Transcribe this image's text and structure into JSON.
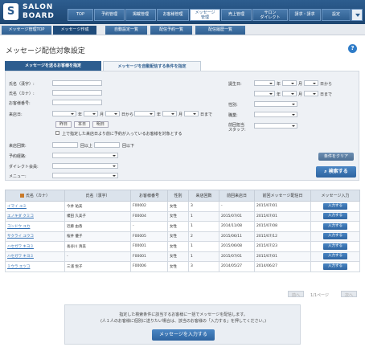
{
  "app": {
    "logo_line1": "SALON",
    "logo_line2": "BOARD",
    "logo_mark": "S"
  },
  "nav": [
    {
      "label": "TOP"
    },
    {
      "label": "予約管理"
    },
    {
      "label": "掲載管理"
    },
    {
      "label": "お客様管理"
    },
    {
      "label1": "メッセージ",
      "label2": "管理"
    },
    {
      "label": "売上管理"
    },
    {
      "label1": "サロン",
      "label2": "ダイレクト"
    },
    {
      "label": "請求・請求"
    },
    {
      "label": "設定"
    }
  ],
  "subtabs": [
    {
      "label": "メッセージ管理TOP"
    },
    {
      "label": "メッセージ作成"
    },
    {
      "label": "自動設定一覧"
    },
    {
      "label": "配信予約一覧"
    },
    {
      "label": "配信履歴一覧"
    }
  ],
  "page_title": "メッセージ配信対象設定",
  "tabs": {
    "specify": "メッセージを送るお客様を指定",
    "auto": "メッセージを自動配信する条件を指定"
  },
  "form": {
    "name_kanji": "氏名（漢字）:",
    "name_kana": "氏名（カナ）:",
    "customer_no": "お客様番号:",
    "visit_date": "来店日:",
    "year": "年",
    "month": "月",
    "day_from": "日から",
    "day_to": "日まで",
    "yesterday": "昨日",
    "today": "本日",
    "tomorrow": "明日",
    "checkbox_label": "上で指定した来店日より前に予約が入っているお客様を対象とする",
    "visit_count": "来店回数:",
    "count_from": "回以上",
    "count_to": "回以下",
    "route": "予約経路:",
    "direct_member": "ダイレクト会員:",
    "menu": "メニュー:",
    "birthday": "誕生日:",
    "gender": "性別:",
    "job": "職業:",
    "last_staff1": "前回担当",
    "last_staff2": "スタッフ:",
    "clear_button": "条件をクリア",
    "search_button": "検索する",
    "search_icon": "search-icon"
  },
  "table": {
    "headers": [
      "氏名（カナ）",
      "氏名（漢字）",
      "お客様番号",
      "性別",
      "来店回数",
      "前回来店日",
      "前回メッセージ配信日",
      "メッセージ入力"
    ],
    "rows": [
      {
        "kana": "イマイ ユミ",
        "kanji": "今井 祐美",
        "no": "F00002",
        "gender": "女性",
        "count": "3",
        "last": "-",
        "msg": "2015/07/01",
        "btn": "入力する"
      },
      {
        "kana": "エノキダ クミコ",
        "kanji": "榎田 久美子",
        "no": "F00004",
        "gender": "女性",
        "count": "1",
        "last": "2015/07/01",
        "msg": "2015/07/01",
        "btn": "入力する"
      },
      {
        "kana": "コンドウ ユカ",
        "kanji": "近藤 由香",
        "no": "-",
        "gender": "女性",
        "count": "1",
        "last": "2014/11/08",
        "msg": "2015/07/08",
        "btn": "入力する"
      },
      {
        "kana": "サクライ ユウコ",
        "kanji": "桜井 優子",
        "no": "F00005",
        "gender": "女性",
        "count": "2",
        "last": "2015/06/11",
        "msg": "2015/07/12",
        "btn": "入力する"
      },
      {
        "kana": "ハセガワ キヨミ",
        "kanji": "長谷川 清美",
        "no": "F00001",
        "gender": "女性",
        "count": "1",
        "last": "2015/06/08",
        "msg": "2015/07/23",
        "btn": "入力する"
      },
      {
        "kana": "ハセガワ キヨミ",
        "kanji": "-",
        "no": "F00001",
        "gender": "女性",
        "count": "1",
        "last": "2015/07/01",
        "msg": "2015/07/01",
        "btn": "入力する"
      },
      {
        "kana": "ミウラ エツコ",
        "kanji": "三浦 悦子",
        "no": "F00006",
        "gender": "女性",
        "count": "3",
        "last": "2014/05/27",
        "msg": "2014/06/27",
        "btn": "入力する"
      }
    ]
  },
  "pagination": {
    "prev": "前へ",
    "page": "1/1ページ",
    "next": "次へ"
  },
  "notice": {
    "line1": "指定した検索条件に該当するお客様に一括でメッセージを配信します。",
    "line2": "(人１人のお客様に個別に送りたい場合は、該当のお客様の「入力する」を押してください。)",
    "button": "メッセージを入力する"
  }
}
